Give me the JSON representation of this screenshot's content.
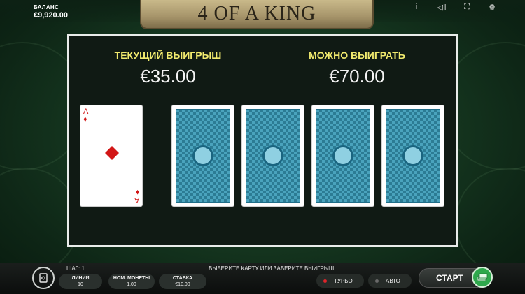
{
  "header": {
    "balance_label": "БАЛАНС",
    "balance_value": "€9,920.00",
    "game_title": "4 OF A KING",
    "icons": [
      "info-icon",
      "sound-icon",
      "fullscreen-icon",
      "settings-icon"
    ],
    "icon_glyphs": {
      "info": "i",
      "sound": "◁‖",
      "fullscreen": "⛶",
      "settings": "⚙"
    }
  },
  "panel": {
    "current_win_label": "ТЕКУЩИЙ ВЫИГРЫШ",
    "current_win_value": "€35.00",
    "possible_win_label": "МОЖНО ВЫИГРАТЬ",
    "possible_win_value": "€70.00",
    "dealer_card": {
      "rank": "A",
      "suit": "diamonds",
      "suit_glyph": "♦",
      "color": "#d21616"
    },
    "choice_cards": [
      {
        "state": "face-down"
      },
      {
        "state": "face-down"
      },
      {
        "state": "face-down"
      },
      {
        "state": "face-down"
      }
    ]
  },
  "bottom": {
    "step_text": "ШАГ: 1",
    "message": "ВЫБЕРИТЕ КАРТУ ИЛИ ЗАБЕРИТЕ ВЫИГРЫШ",
    "lines_label": "ЛИНИИ",
    "lines_value": "10",
    "coin_label": "НОМ. МОНЕТЫ",
    "coin_value": "1.00",
    "bet_label": "СТАВКА",
    "bet_value": "€10.00",
    "turbo_label": "ТУРБО",
    "auto_label": "АВТО",
    "start_label": "СТАРТ",
    "turbo_dot_color": "#e0242a",
    "auto_dot_color": "#6a6a6a",
    "collect_color": "#2ea84c"
  }
}
